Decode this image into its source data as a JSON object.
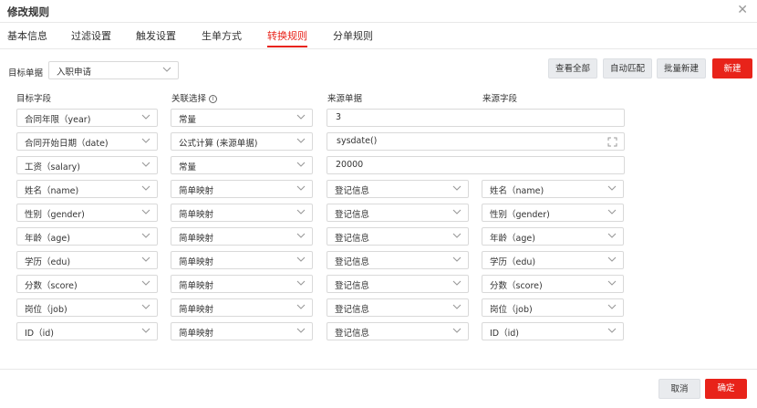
{
  "dialog": {
    "title": "修改规则"
  },
  "tabs": [
    {
      "label": "基本信息"
    },
    {
      "label": "过滤设置"
    },
    {
      "label": "触发设置"
    },
    {
      "label": "生单方式"
    },
    {
      "label": "转换规则",
      "active": true
    },
    {
      "label": "分单规则"
    }
  ],
  "toolbar": {
    "target_label": "目标单据",
    "target_value": "入职申请",
    "view_all": "查看全部",
    "auto_match": "自动匹配",
    "batch_new": "批量新建",
    "new": "新建"
  },
  "columns": {
    "target_field": "目标字段",
    "relation": "关联选择",
    "source_doc": "来源单据",
    "source_field": "来源字段"
  },
  "rows": [
    {
      "target": "合同年限（year)",
      "relation": "常量",
      "source": "3",
      "source_type": "input"
    },
    {
      "target": "合同开始日期（date)",
      "relation": "公式计算 (来源单据)",
      "source": "sysdate()",
      "source_type": "formula"
    },
    {
      "target": "工资（salary)",
      "relation": "常量",
      "source": "20000",
      "source_type": "input"
    },
    {
      "target": "姓名（name)",
      "relation": "简单映射",
      "source": "登记信息",
      "source_type": "select",
      "field": "姓名（name)"
    },
    {
      "target": "性别（gender)",
      "relation": "简单映射",
      "source": "登记信息",
      "source_type": "select",
      "field": "性别（gender)"
    },
    {
      "target": "年龄（age)",
      "relation": "简单映射",
      "source": "登记信息",
      "source_type": "select",
      "field": "年龄（age)"
    },
    {
      "target": "学历（edu)",
      "relation": "简单映射",
      "source": "登记信息",
      "source_type": "select",
      "field": "学历（edu)"
    },
    {
      "target": "分数（score)",
      "relation": "简单映射",
      "source": "登记信息",
      "source_type": "select",
      "field": "分数（score)"
    },
    {
      "target": "岗位（job)",
      "relation": "简单映射",
      "source": "登记信息",
      "source_type": "select",
      "field": "岗位（job)"
    },
    {
      "target": "ID（id)",
      "relation": "简单映射",
      "source": "登记信息",
      "source_type": "select",
      "field": "ID（id)"
    }
  ],
  "footer": {
    "cancel": "取消",
    "ok": "确定"
  },
  "colors": {
    "accent": "#e8231a",
    "border": "#d9d9d9",
    "button_bg": "#e9ebee"
  },
  "icons": {
    "close": "close-icon",
    "chevron": "chevron-down-icon",
    "info": "info-icon",
    "expand": "expand-icon"
  }
}
